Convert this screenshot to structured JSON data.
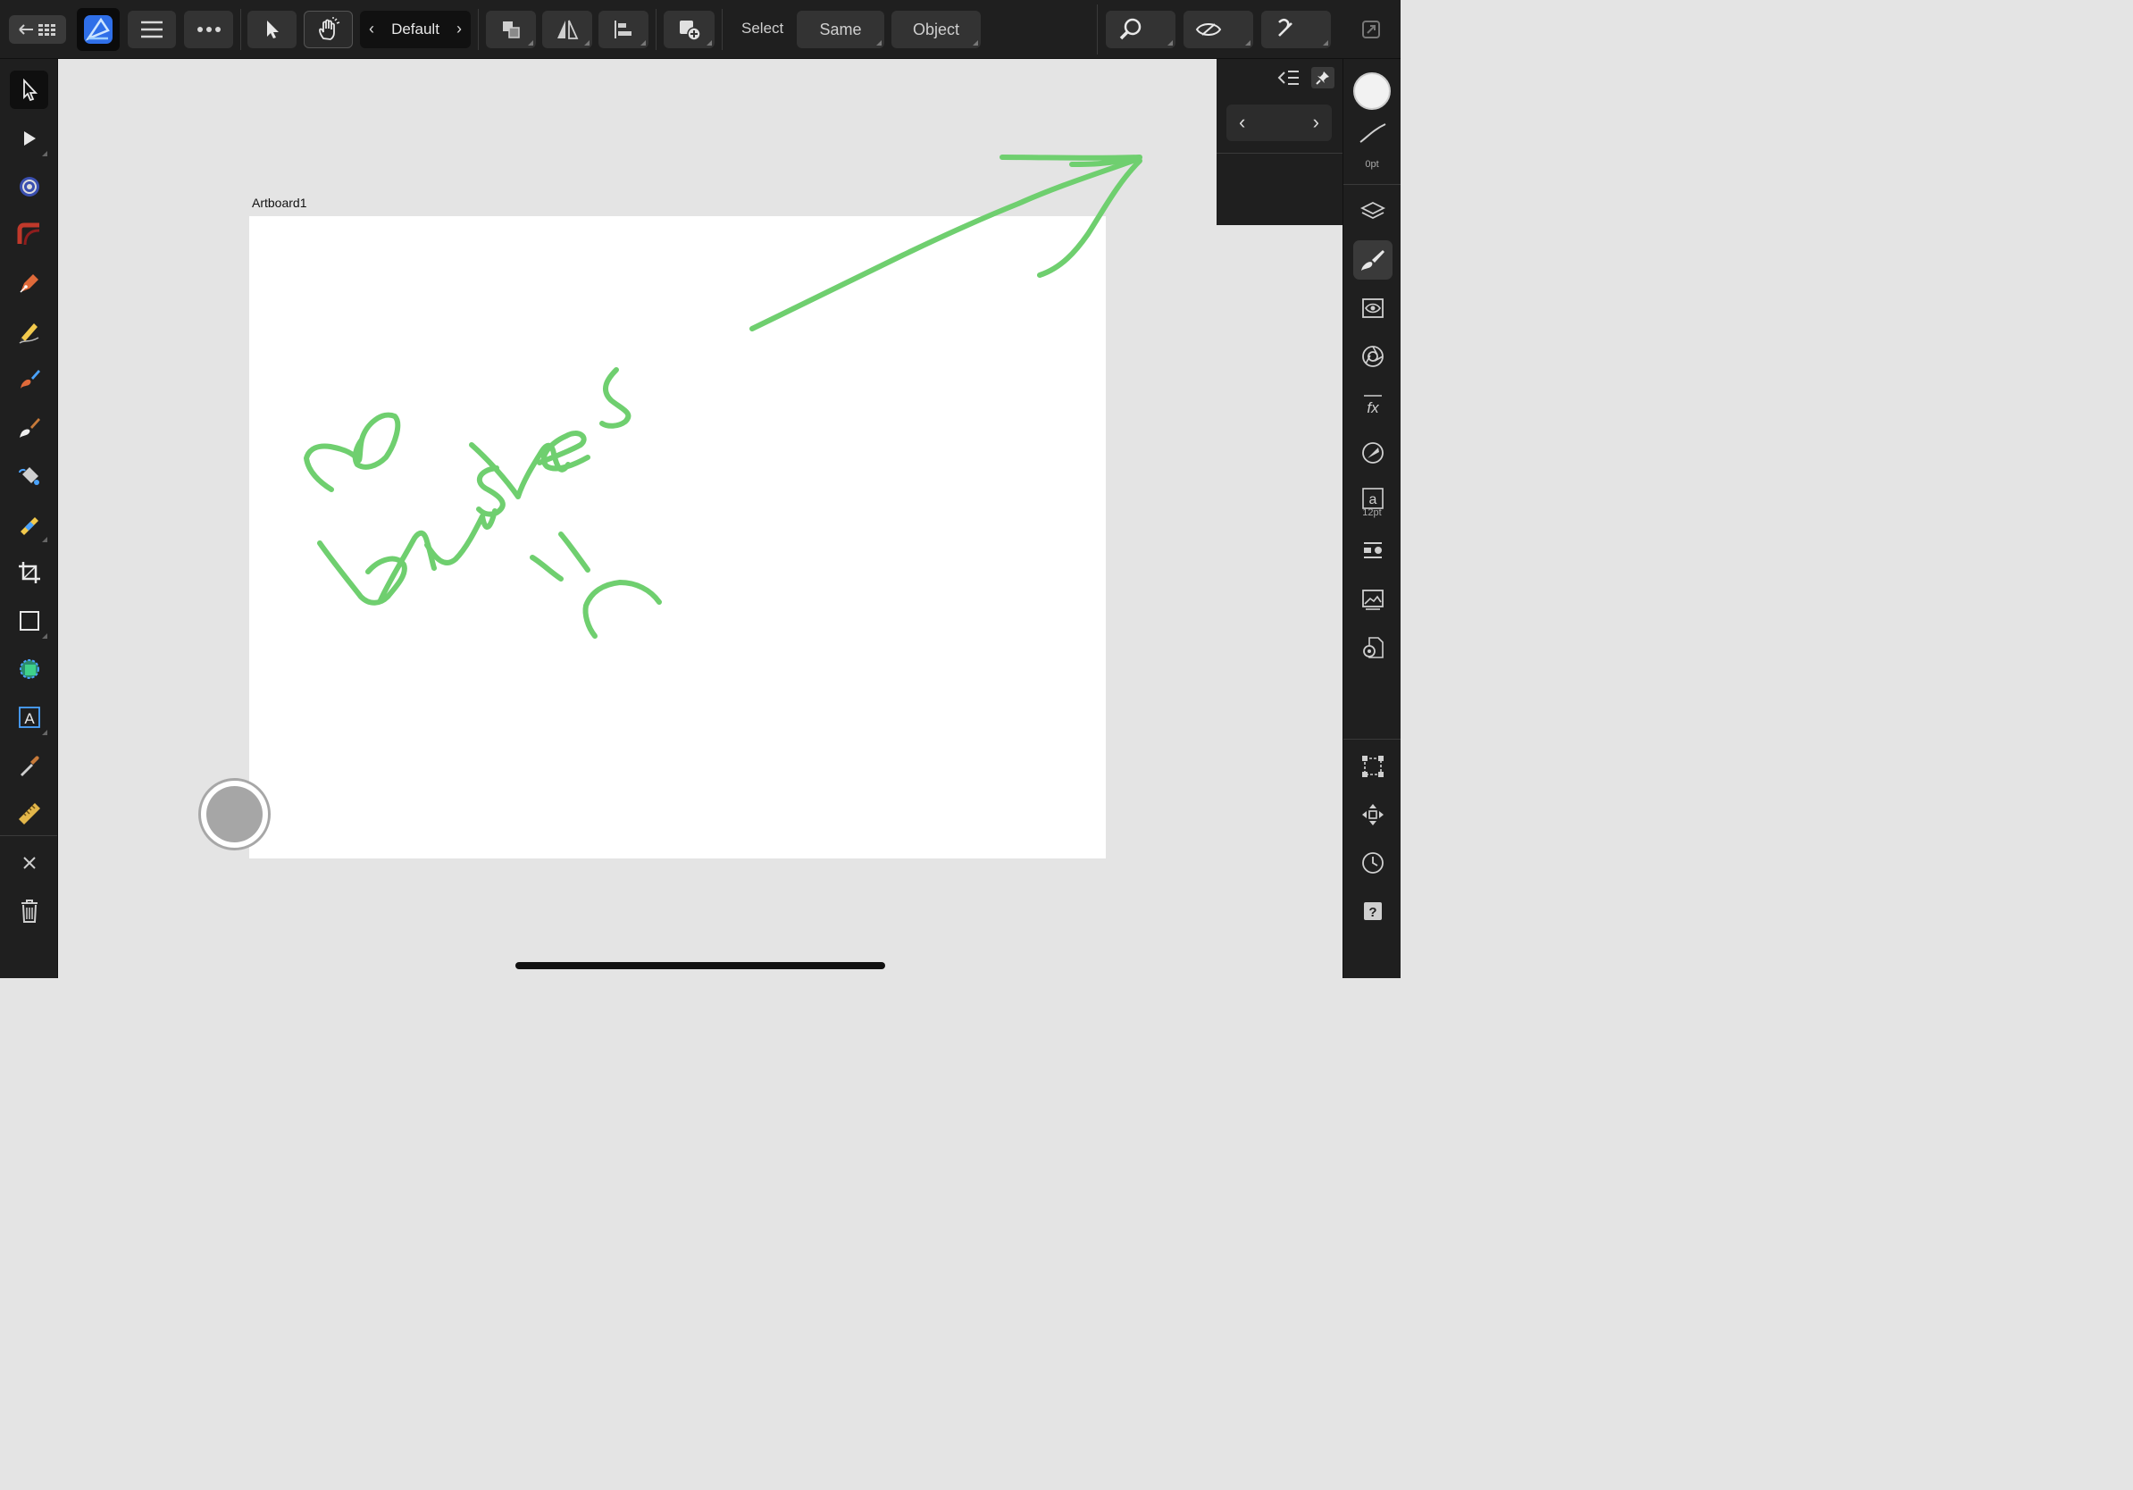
{
  "toolbar": {
    "persona_label": "Default",
    "select_label": "Select",
    "same_label": "Same",
    "object_label": "Object"
  },
  "artboard": {
    "name": "Artboard1"
  },
  "drawing": {
    "stroke_color": "#6fcf6f"
  },
  "right_panel": {
    "stroke_width_label": "0pt",
    "text_size_label": "12pt"
  },
  "colors": {
    "app_accent": "#2f6fe8",
    "panel_bg": "#1f1f1f",
    "canvas_bg": "#e4e4e4"
  },
  "icons": {
    "left_tools": [
      "move-tool-icon",
      "node-tool-icon",
      "corner-tool-icon",
      "contour-tool-icon",
      "pen-tool-icon",
      "pencil-tool-icon",
      "vector-brush-icon",
      "paint-brush-icon",
      "fill-tool-icon",
      "transparency-tool-icon",
      "crop-tool-icon",
      "rectangle-tool-icon",
      "shape-builder-icon",
      "artistic-text-icon",
      "color-picker-icon",
      "measure-tool-icon"
    ],
    "right_studios": [
      "color-swatch-icon",
      "stroke-icon",
      "layers-icon",
      "brushes-icon",
      "appearance-icon",
      "styles-icon",
      "effects-icon",
      "adjustments-icon",
      "text-styles-icon",
      "symbols-icon",
      "stock-icon",
      "document-settings-icon",
      "transform-icon",
      "navigator-icon",
      "history-icon",
      "help-icon"
    ]
  }
}
